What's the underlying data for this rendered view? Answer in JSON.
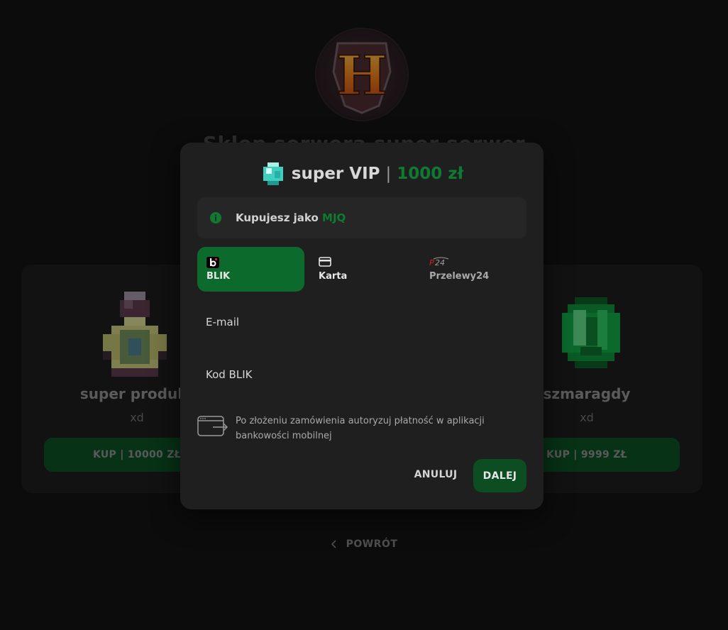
{
  "shop": {
    "logo_letter": "H",
    "title": "Sklep serwera super serwer"
  },
  "products": [
    {
      "name": "super produkt",
      "desc": "xd",
      "buy_label": "KUP | 10000 ZŁ",
      "icon": "potion-icon"
    },
    {
      "name": "szmaragdy",
      "desc": "xd",
      "buy_label": "KUP | 9999 ZŁ",
      "icon": "emerald-icon"
    }
  ],
  "back": {
    "label": "POWRÓT",
    "icon": "chevron-left-icon"
  },
  "modal": {
    "product_name": "super VIP",
    "separator": "|",
    "price": "1000 zł",
    "product_icon": "diamond-icon",
    "info": {
      "prefix": "Kupujesz jako",
      "user": "MJQ",
      "icon": "info-icon"
    },
    "tabs": [
      {
        "label": "BLIK",
        "icon": "blik-icon",
        "active": true
      },
      {
        "label": "Karta",
        "icon": "card-icon",
        "active": false
      },
      {
        "label": "Przelewy24",
        "icon": "p24-icon",
        "active": false
      }
    ],
    "fields": {
      "email_label": "E-mail",
      "blik_label": "Kod BLIK"
    },
    "note": {
      "text": "Po złożeniu zamówienia autoryzuj płatność w aplikacji bankowości mobilnej",
      "icon": "app-redirect-icon"
    },
    "buttons": {
      "cancel": "ANULUJ",
      "next": "DALEJ"
    }
  },
  "colors": {
    "accent": "#0f7b31",
    "button": "#0c4d22",
    "active_tab": "#0c6b2c",
    "modal_bg": "#1f1f1f",
    "page_bg": "#131313"
  }
}
